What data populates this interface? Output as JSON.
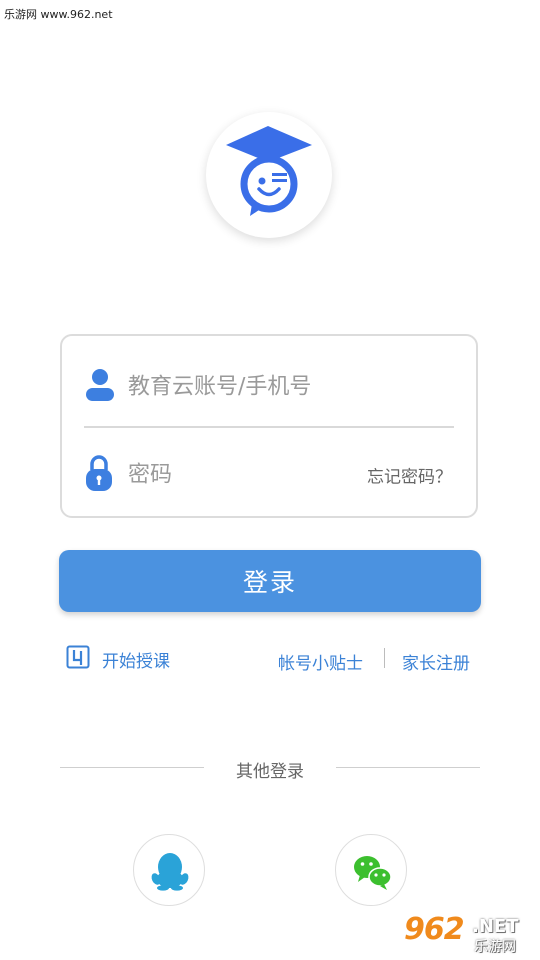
{
  "watermark": {
    "text": "乐游网 www.962.net"
  },
  "logo": {
    "icon": "graduation-cap-chat-icon",
    "colors": {
      "primary": "#3a6ee8"
    }
  },
  "login_form": {
    "username_placeholder": "教育云账号/手机号",
    "password_placeholder": "密码",
    "forgot_password": "忘记密码？"
  },
  "login_button": {
    "label": "登录",
    "color": "#4b92e0"
  },
  "links": {
    "start_teaching": "开始授课",
    "account_tips": "帐号小贴士",
    "parent_register": "家长注册",
    "link_color": "#3b82d6"
  },
  "other_login": {
    "title": "其他登录",
    "providers": [
      {
        "name": "QQ",
        "icon": "qq-penguin-icon",
        "color": "#2aa3d8"
      },
      {
        "name": "WeChat",
        "icon": "wechat-icon",
        "color": "#3cbf2e"
      }
    ]
  },
  "corner_watermark": {
    "number": "962",
    "suffix": ".NET",
    "cn": "乐游网"
  }
}
